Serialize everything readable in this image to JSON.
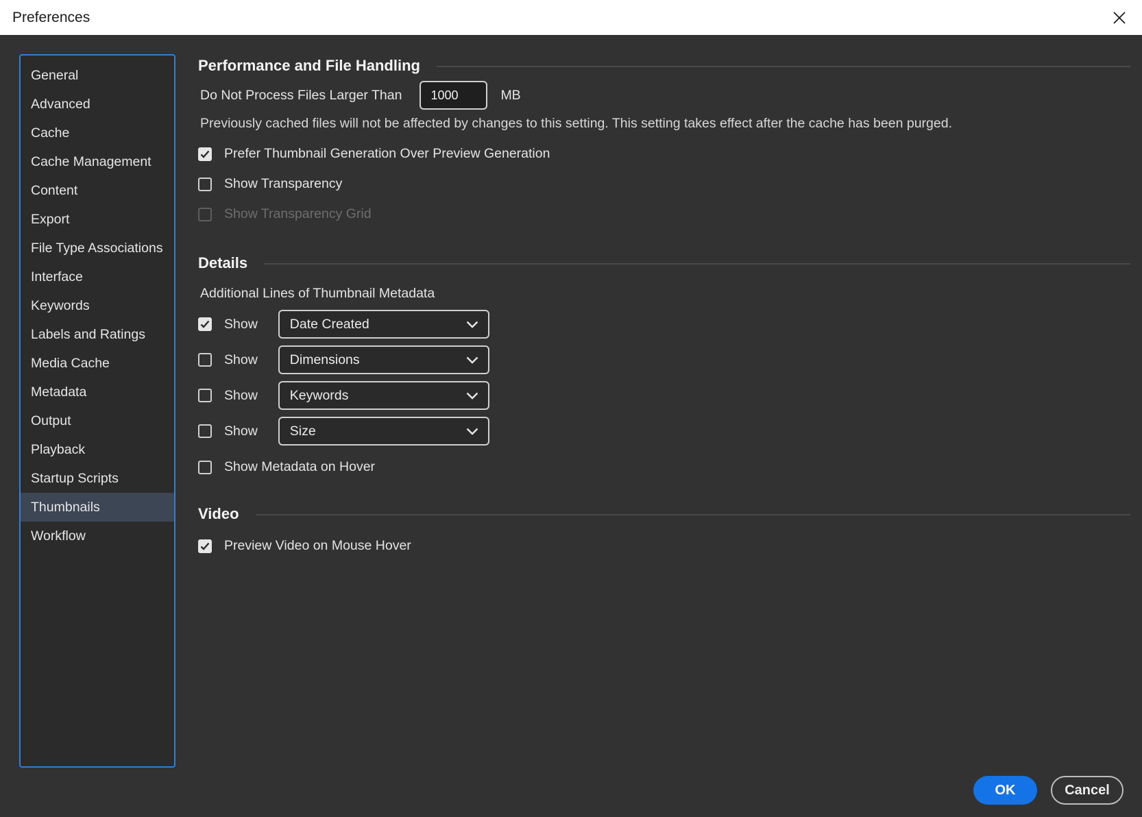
{
  "window": {
    "title": "Preferences"
  },
  "sidebar": {
    "items": [
      {
        "label": "General",
        "active": false
      },
      {
        "label": "Advanced",
        "active": false
      },
      {
        "label": "Cache",
        "active": false
      },
      {
        "label": "Cache Management",
        "active": false
      },
      {
        "label": "Content",
        "active": false
      },
      {
        "label": "Export",
        "active": false
      },
      {
        "label": "File Type Associations",
        "active": false
      },
      {
        "label": "Interface",
        "active": false
      },
      {
        "label": "Keywords",
        "active": false
      },
      {
        "label": "Labels and Ratings",
        "active": false
      },
      {
        "label": "Media Cache",
        "active": false
      },
      {
        "label": "Metadata",
        "active": false
      },
      {
        "label": "Output",
        "active": false
      },
      {
        "label": "Playback",
        "active": false
      },
      {
        "label": "Startup Scripts",
        "active": false
      },
      {
        "label": "Thumbnails",
        "active": true
      },
      {
        "label": "Workflow",
        "active": false
      }
    ]
  },
  "performance": {
    "heading": "Performance and File Handling",
    "max_file_label": "Do Not Process Files Larger Than",
    "max_file_value": "1000",
    "max_file_unit": "MB",
    "note": "Previously cached files will not be affected by changes to this setting. This setting takes effect after the cache has been purged.",
    "prefer_thumbnail": {
      "label": "Prefer Thumbnail Generation Over Preview Generation",
      "checked": true
    },
    "show_transparency": {
      "label": "Show Transparency",
      "checked": false
    },
    "show_transparency_grid": {
      "label": "Show Transparency Grid",
      "checked": false,
      "disabled": true
    }
  },
  "details": {
    "heading": "Details",
    "subheading": "Additional Lines of Thumbnail Metadata",
    "lines": [
      {
        "show_label": "Show",
        "checked": true,
        "value": "Date Created"
      },
      {
        "show_label": "Show",
        "checked": false,
        "value": "Dimensions"
      },
      {
        "show_label": "Show",
        "checked": false,
        "value": "Keywords"
      },
      {
        "show_label": "Show",
        "checked": false,
        "value": "Size"
      }
    ],
    "metadata_hover": {
      "label": "Show Metadata on Hover",
      "checked": false
    }
  },
  "video": {
    "heading": "Video",
    "preview_hover": {
      "label": "Preview Video on Mouse Hover",
      "checked": true
    }
  },
  "footer": {
    "ok_label": "OK",
    "cancel_label": "Cancel"
  },
  "colors": {
    "accent": "#1473e6",
    "sidebar_border": "#2f7fd6",
    "background": "#323232",
    "active_item": "#3d4654"
  }
}
